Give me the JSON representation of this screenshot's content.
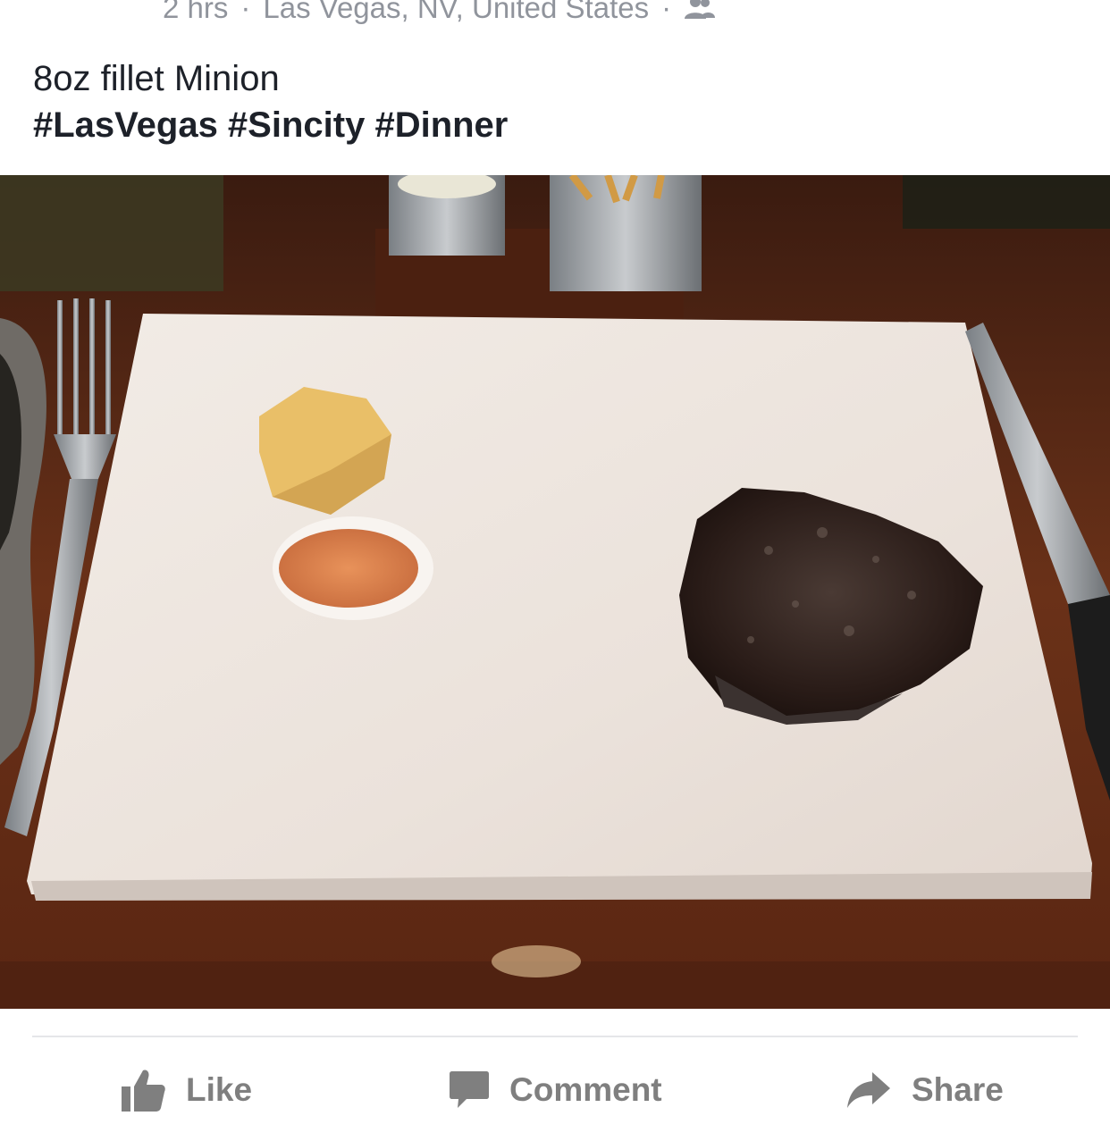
{
  "post": {
    "time": "2 hrs",
    "separator": "·",
    "location": "Las Vegas, NV, United States",
    "audience_icon": "friends-icon",
    "caption": "8oz fillet Minion",
    "hashtags": "#LasVegas #Sincity #Dinner"
  },
  "actions": {
    "like_label": "Like",
    "comment_label": "Comment",
    "share_label": "Share",
    "icons": [
      "thumbs-up-icon",
      "speech-bubble-icon",
      "share-arrow-icon"
    ]
  },
  "colors": {
    "text": "#1d2129",
    "meta_text": "#90949c",
    "action_text": "#7f7f7f",
    "divider": "#e5e6e9"
  }
}
